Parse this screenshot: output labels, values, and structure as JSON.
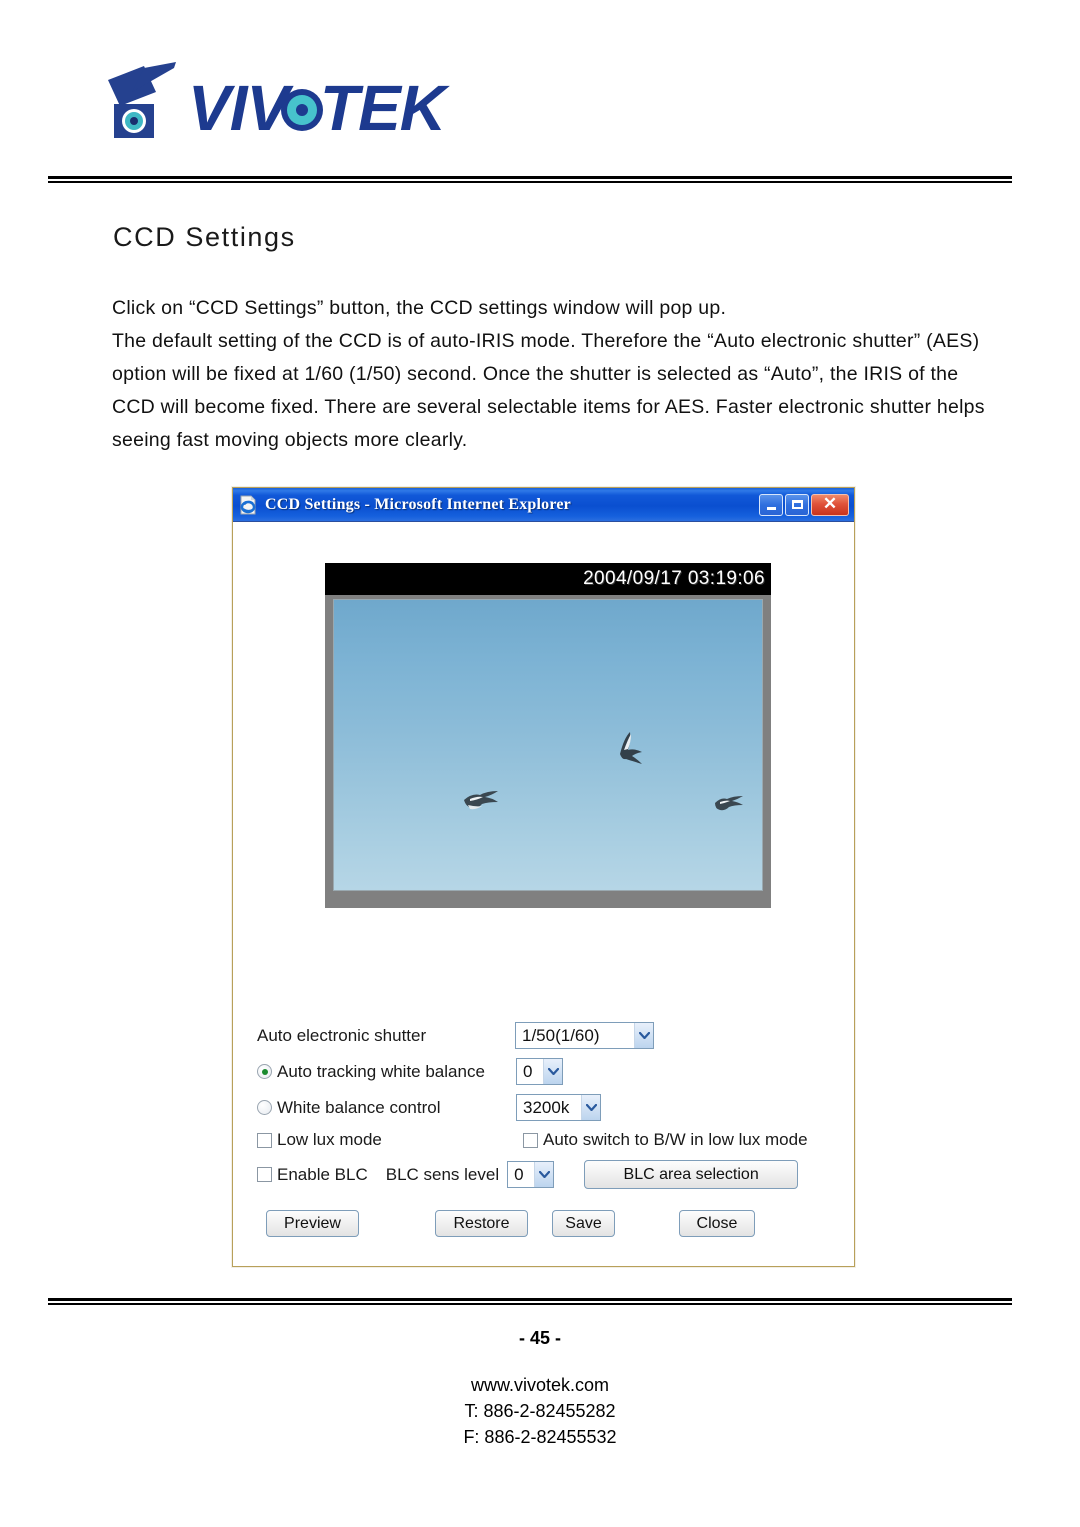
{
  "header": {
    "logo_text": "VIVOTEK",
    "logo_icon": "vivotek-camera-logo"
  },
  "document": {
    "heading": "CCD Settings",
    "paragraphs": [
      "Click on “CCD Settings” button, the CCD settings window will pop up.",
      "The default setting of the CCD is of auto-IRIS mode. Therefore the “Auto electronic shutter” (AES) option will be fixed at 1/60 (1/50) second. Once the shutter is selected as “Auto”, the IRIS of the CCD will become fixed. There are several selectable items for AES. Faster electronic shutter helps seeing fast moving objects more clearly."
    ]
  },
  "dialog": {
    "title": "CCD Settings - Microsoft Internet Explorer",
    "icon": "ie-page-icon",
    "window_buttons": {
      "minimize": "minimize-icon",
      "maximize": "maximize-icon",
      "close": "close-icon",
      "close_glyph": "✕"
    },
    "video": {
      "timestamp": "2004/09/17 03:19:06",
      "description": "live-preview-birds-in-blue-sky"
    },
    "controls": {
      "shutter_label": "Auto electronic shutter",
      "shutter_value": "1/50(1/60)",
      "atw_label": "Auto tracking white balance",
      "atw_selected": true,
      "atw_value": "0",
      "wbc_label": "White balance control",
      "wbc_selected": false,
      "wbc_value": "3200k",
      "low_lux_label": "Low lux mode",
      "low_lux_checked": false,
      "auto_bw_label": "Auto switch to B/W in low lux mode",
      "auto_bw_checked": false,
      "enable_blc_label": "Enable BLC",
      "enable_blc_checked": false,
      "blc_sens_label": "BLC sens level",
      "blc_sens_value": "0",
      "blc_area_button": "BLC area selection"
    },
    "buttons": {
      "preview": "Preview",
      "restore": "Restore",
      "save": "Save",
      "close": "Close"
    }
  },
  "footer": {
    "page_number": "- 45 -",
    "website": "www.vivotek.com",
    "tel": "T: 886-2-82455282",
    "fax": "F: 886-2-82455532"
  },
  "colors": {
    "title_bar_blue": "#0a4fd0",
    "close_red": "#c8331c",
    "dialog_border": "#b8a05a",
    "radio_dot_green": "#1a8a2e"
  }
}
